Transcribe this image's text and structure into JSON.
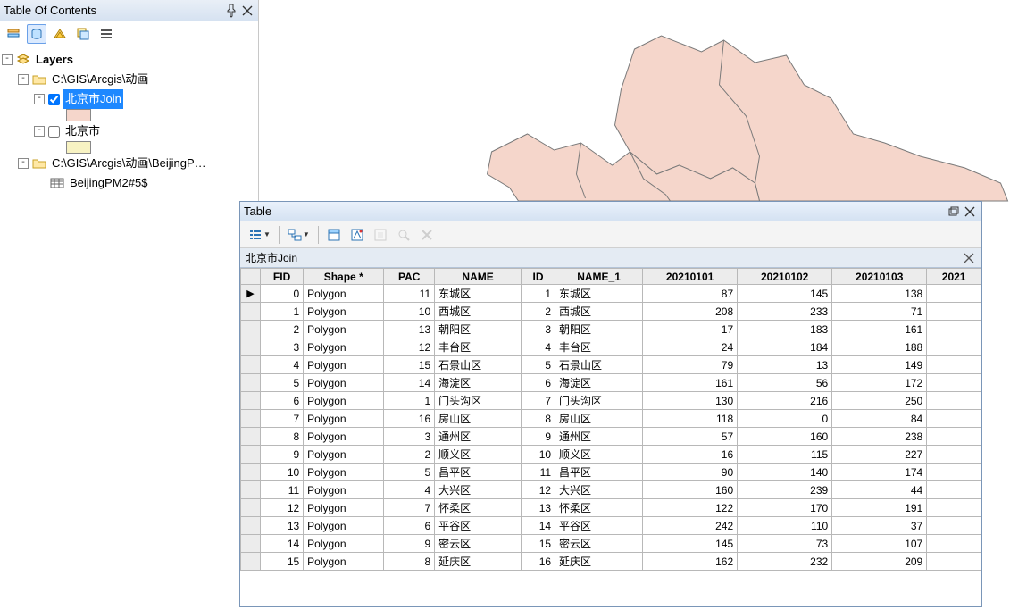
{
  "toc": {
    "title": "Table Of Contents",
    "pin_icon": "pin-icon",
    "close_icon": "close-icon",
    "root_label": "Layers",
    "group1_label": "C:\\GIS\\Arcgis\\动画",
    "layer1_label": "北京市Join",
    "layer1_swatch_color": "#f5d6cb",
    "layer2_label": "北京市",
    "layer2_swatch_color": "#f8f3c3",
    "group2_label": "C:\\GIS\\Arcgis\\动画\\BeijingP…",
    "table1_label": "BeijingPM2#5$"
  },
  "map": {
    "feature_fill": "#f5d6cb",
    "feature_stroke": "#7a7a7a"
  },
  "table_window": {
    "title": "Table",
    "tab_name": "北京市Join",
    "columns": [
      "",
      "FID",
      "Shape *",
      "PAC",
      "NAME",
      "ID",
      "NAME_1",
      "20210101",
      "20210102",
      "20210103",
      "2021"
    ],
    "rows": [
      {
        "fid": 0,
        "shape": "Polygon",
        "pac": 11,
        "name": "东城区",
        "id": 1,
        "name1": "东城区",
        "d1": 87,
        "d2": 145,
        "d3": 138
      },
      {
        "fid": 1,
        "shape": "Polygon",
        "pac": 10,
        "name": "西城区",
        "id": 2,
        "name1": "西城区",
        "d1": 208,
        "d2": 233,
        "d3": 71
      },
      {
        "fid": 2,
        "shape": "Polygon",
        "pac": 13,
        "name": "朝阳区",
        "id": 3,
        "name1": "朝阳区",
        "d1": 17,
        "d2": 183,
        "d3": 161
      },
      {
        "fid": 3,
        "shape": "Polygon",
        "pac": 12,
        "name": "丰台区",
        "id": 4,
        "name1": "丰台区",
        "d1": 24,
        "d2": 184,
        "d3": 188
      },
      {
        "fid": 4,
        "shape": "Polygon",
        "pac": 15,
        "name": "石景山区",
        "id": 5,
        "name1": "石景山区",
        "d1": 79,
        "d2": 13,
        "d3": 149
      },
      {
        "fid": 5,
        "shape": "Polygon",
        "pac": 14,
        "name": "海淀区",
        "id": 6,
        "name1": "海淀区",
        "d1": 161,
        "d2": 56,
        "d3": 172
      },
      {
        "fid": 6,
        "shape": "Polygon",
        "pac": 1,
        "name": "门头沟区",
        "id": 7,
        "name1": "门头沟区",
        "d1": 130,
        "d2": 216,
        "d3": 250
      },
      {
        "fid": 7,
        "shape": "Polygon",
        "pac": 16,
        "name": "房山区",
        "id": 8,
        "name1": "房山区",
        "d1": 118,
        "d2": 0,
        "d3": 84
      },
      {
        "fid": 8,
        "shape": "Polygon",
        "pac": 3,
        "name": "通州区",
        "id": 9,
        "name1": "通州区",
        "d1": 57,
        "d2": 160,
        "d3": 238
      },
      {
        "fid": 9,
        "shape": "Polygon",
        "pac": 2,
        "name": "顺义区",
        "id": 10,
        "name1": "顺义区",
        "d1": 16,
        "d2": 115,
        "d3": 227
      },
      {
        "fid": 10,
        "shape": "Polygon",
        "pac": 5,
        "name": "昌平区",
        "id": 11,
        "name1": "昌平区",
        "d1": 90,
        "d2": 140,
        "d3": 174
      },
      {
        "fid": 11,
        "shape": "Polygon",
        "pac": 4,
        "name": "大兴区",
        "id": 12,
        "name1": "大兴区",
        "d1": 160,
        "d2": 239,
        "d3": 44
      },
      {
        "fid": 12,
        "shape": "Polygon",
        "pac": 7,
        "name": "怀柔区",
        "id": 13,
        "name1": "怀柔区",
        "d1": 122,
        "d2": 170,
        "d3": 191
      },
      {
        "fid": 13,
        "shape": "Polygon",
        "pac": 6,
        "name": "平谷区",
        "id": 14,
        "name1": "平谷区",
        "d1": 242,
        "d2": 110,
        "d3": 37
      },
      {
        "fid": 14,
        "shape": "Polygon",
        "pac": 9,
        "name": "密云区",
        "id": 15,
        "name1": "密云区",
        "d1": 145,
        "d2": 73,
        "d3": 107
      },
      {
        "fid": 15,
        "shape": "Polygon",
        "pac": 8,
        "name": "延庆区",
        "id": 16,
        "name1": "延庆区",
        "d1": 162,
        "d2": 232,
        "d3": 209
      }
    ]
  }
}
